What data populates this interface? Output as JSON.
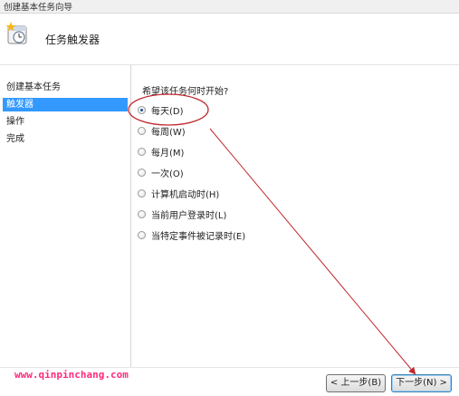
{
  "window": {
    "title": "创建基本任务向导"
  },
  "header": {
    "title": "任务触发器",
    "icon": "calendar-clock-icon"
  },
  "sidebar": {
    "items": [
      {
        "label": "创建基本任务"
      },
      {
        "label": "触发器",
        "active": true
      },
      {
        "label": "操作"
      },
      {
        "label": "完成"
      }
    ]
  },
  "main": {
    "question": "希望该任务何时开始?",
    "options": [
      {
        "label": "每天(D)",
        "checked": true
      },
      {
        "label": "每周(W)"
      },
      {
        "label": "每月(M)"
      },
      {
        "label": "一次(O)"
      },
      {
        "label": "计算机启动时(H)"
      },
      {
        "label": "当前用户登录时(L)"
      },
      {
        "label": "当特定事件被记录时(E)"
      }
    ]
  },
  "watermark": "www.qinpinchang.com",
  "buttons": {
    "back": "< 上一步(B)",
    "next": "下一步(N) >"
  },
  "colors": {
    "selection": "#3399ff",
    "annotation": "#c0272d",
    "watermark": "#ff2a7a"
  }
}
